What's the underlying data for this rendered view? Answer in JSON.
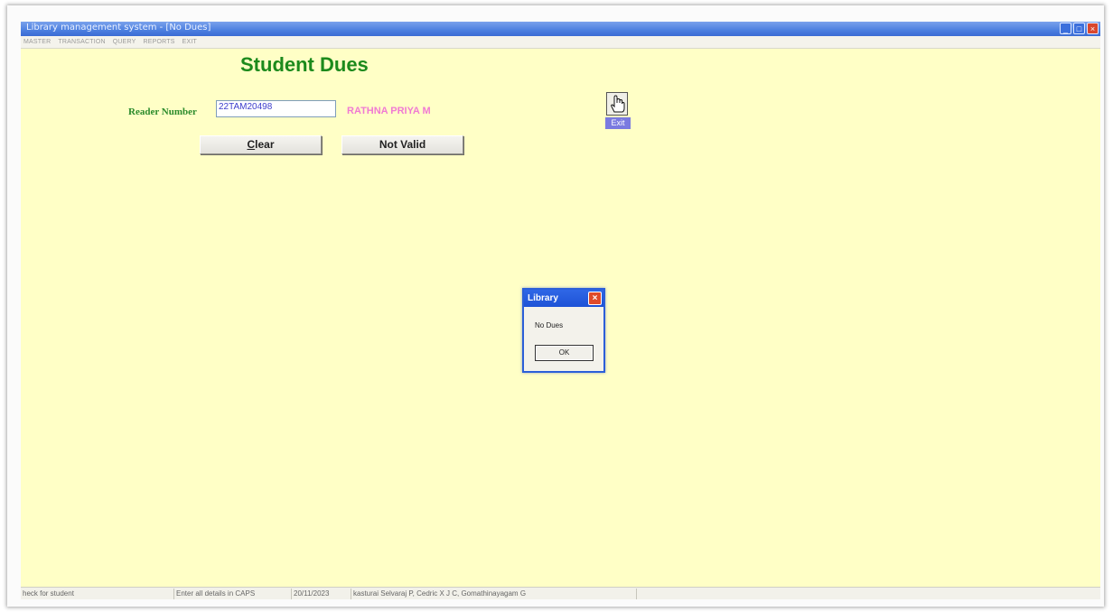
{
  "window": {
    "title": "Library management system - [No Dues]",
    "controls": {
      "minimize": "_",
      "maximize": "□",
      "close": "×"
    }
  },
  "menu": [
    "MASTER",
    "TRANSACTION",
    "QUERY",
    "REPORTS",
    "EXIT"
  ],
  "form": {
    "title": "Student Dues",
    "reader_label": "Reader Number",
    "reader_value": "22TAM20498",
    "reader_name": "RATHNA PRIYA M",
    "clear_label": "Clear",
    "not_valid_label": "Not Valid",
    "exit_label": "Exit",
    "exit_icon": "hand-pointer-icon"
  },
  "dialog": {
    "title": "Library",
    "message": "No Dues",
    "ok_label": "OK",
    "close_glyph": "×"
  },
  "status": {
    "cells": [
      "heck for student",
      "Enter all details in CAPS",
      "20/11/2023",
      "kasturai Selvaraj P, Cedric X J C, Gomathinayagam G"
    ]
  },
  "colors": {
    "form_background": "#ffffc6",
    "title_green": "#1c8a1c",
    "name_pink": "#f07ad3",
    "titlebar_blue": "#4c7fe0"
  }
}
